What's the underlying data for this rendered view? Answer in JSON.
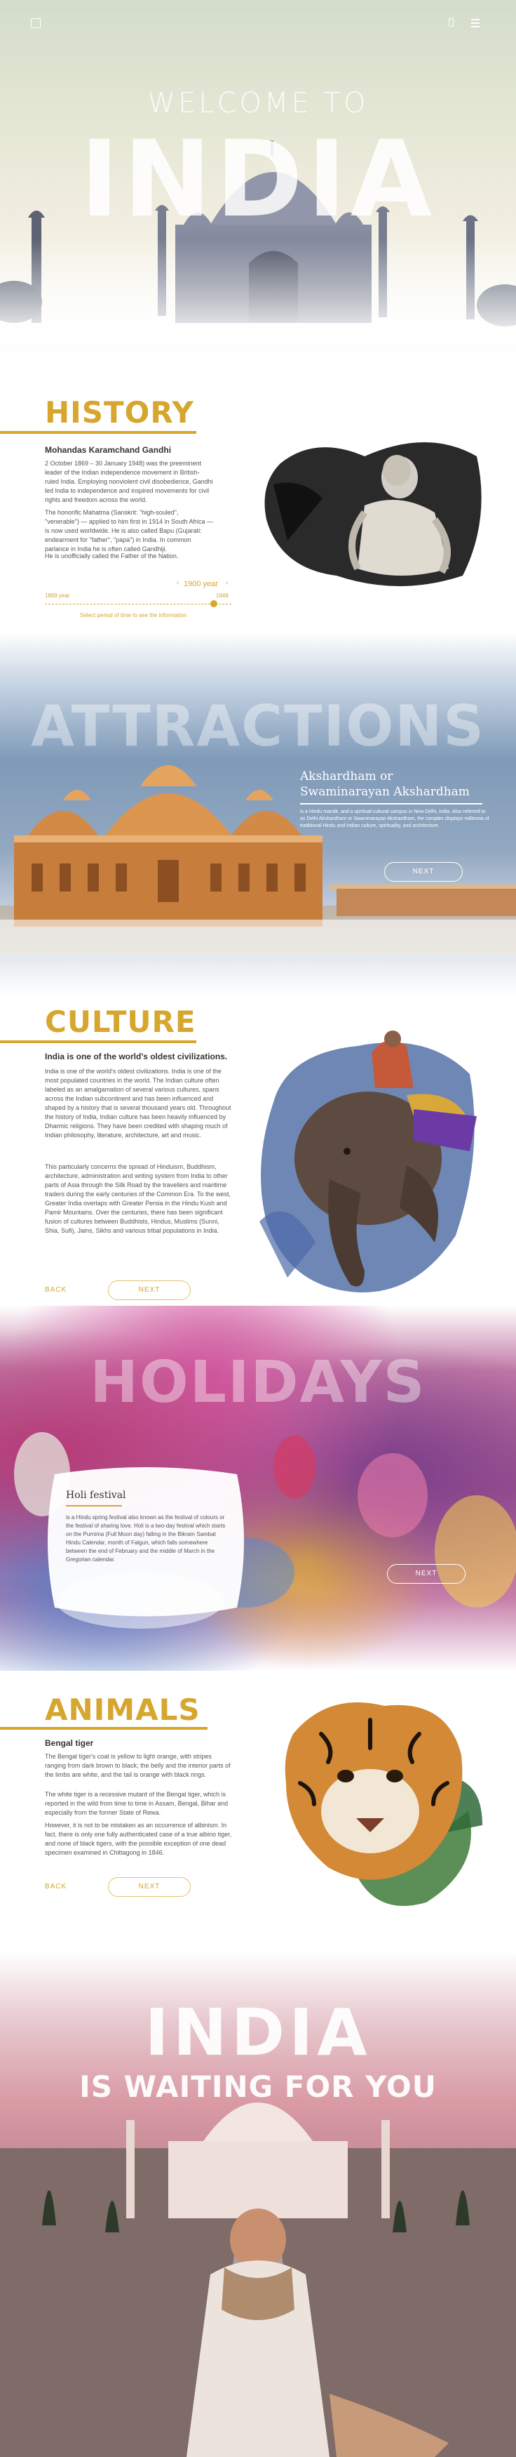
{
  "header": {
    "logo_icon": "logo-square-icon",
    "menu_icons": [
      "phone-icon",
      "menu-icon"
    ]
  },
  "hero": {
    "welcome": "WELCOME TO",
    "title": "INDIA"
  },
  "history": {
    "heading": "HISTORY",
    "subtitle": "Mohandas Karamchand Gandhi",
    "p1": "2 October 1869 – 30 January 1948) was the preeminent leader of the Indian independence movement in British-ruled India. Employing nonviolent civil disobedience, Gandhi led India to independence and inspired movements for civil rights and freedom across the world.",
    "p2": "The honorific Mahatma (Sanskrit: \"high-souled\", \"venerable\") — applied to him first in 1914 in South Africa — is now used worldwide. He is also called Bapu (Gujarati: endearment for \"father\", \"papa\") in India. In common parlance in India he is often called Gandhiji.",
    "p3": "He is unofficially called the Father of the Nation.",
    "timeline_start": "1869 year",
    "timeline_end": "1948",
    "timeline_current": "1900 year",
    "timeline_hint": "Select period of time to see the information"
  },
  "attractions": {
    "heading": "ATTRACTIONS",
    "title_line1": "Akshardham or",
    "title_line2": "Swaminarayan Akshardham",
    "description": "is a Hindu mandir, and a spiritual-cultural campus in New Delhi, India. Also referred to as Delhi Akshardham or Swaminarayan Akshardham, the complex displays millennia of traditional Hindu and Indian culture, spirituality, and architecture.",
    "next": "NEXT"
  },
  "culture": {
    "heading": "CULTURE",
    "subtitle": "India is one of the world's oldest civilizations.",
    "p1": "India is one of the world's oldest civilizations. India is one of the most populated countries in the world. The Indian culture often labeled as an amalgamation of several various cultures, spans across the Indian subcontinent and has been influenced and shaped by a history that is several thousand years old. Throughout the history of India, Indian culture has been heavily influenced by Dharmic religions. They have been credited with shaping much of Indian philosophy, literature, architecture, art and music.",
    "p2": "This particularly concerns the spread of Hinduism, Buddhism, architecture, administration and writing system from India to other parts of Asia through the Silk Road by the travellers and maritime traders during the early centuries of the Common Era. To the west, Greater India overlaps with Greater Persia in the Hindu Kush and Pamir Mountains. Over the centuries, there has been significant fusion of cultures between Buddhists, Hindus, Muslims (Sunni, Shia, Sufi), Jains, Sikhs and various tribal populations in India.",
    "back": "BACK",
    "next": "NEXT"
  },
  "holidays": {
    "heading": "HOLIDAYS",
    "title": "Holi festival",
    "description": "is a Hindu spring festival also known as the festival of colours or the festival of sharing love. Holi is a two-day festival which starts on the Purnima (Full Moon day) falling in the Bikram Sambat Hindu Calendar, month of Falgun, which falls somewhere between the end of February and the middle of March in the Gregorian calendar.",
    "next": "NEXT"
  },
  "animals": {
    "heading": "ANIMALS",
    "subtitle": "Bengal tiger",
    "p1": "The Bengal tiger's coat is yellow to light orange, with stripes ranging from dark brown to black; the belly and the interior parts of the limbs are white, and the tail is orange with black rings.",
    "p2": "The white tiger is a recessive mutant of the Bengal tiger, which is reported in the wild from time to time in Assam, Bengal, Bihar and especially from the former State of Rewa.",
    "p3": "However, it is not to be mistaken as an occurrence of albinism. In fact, there is only one fully authenticated case of a true albino tiger, and none of black tigers, with the possible exception of one dead specimen examined in Chittagong in 1846.",
    "back": "BACK",
    "next": "NEXT"
  },
  "footer": {
    "title": "INDIA",
    "tagline": "IS WAITING FOR YOU"
  },
  "colors": {
    "accent": "#d6a62e",
    "text": "#333333"
  }
}
